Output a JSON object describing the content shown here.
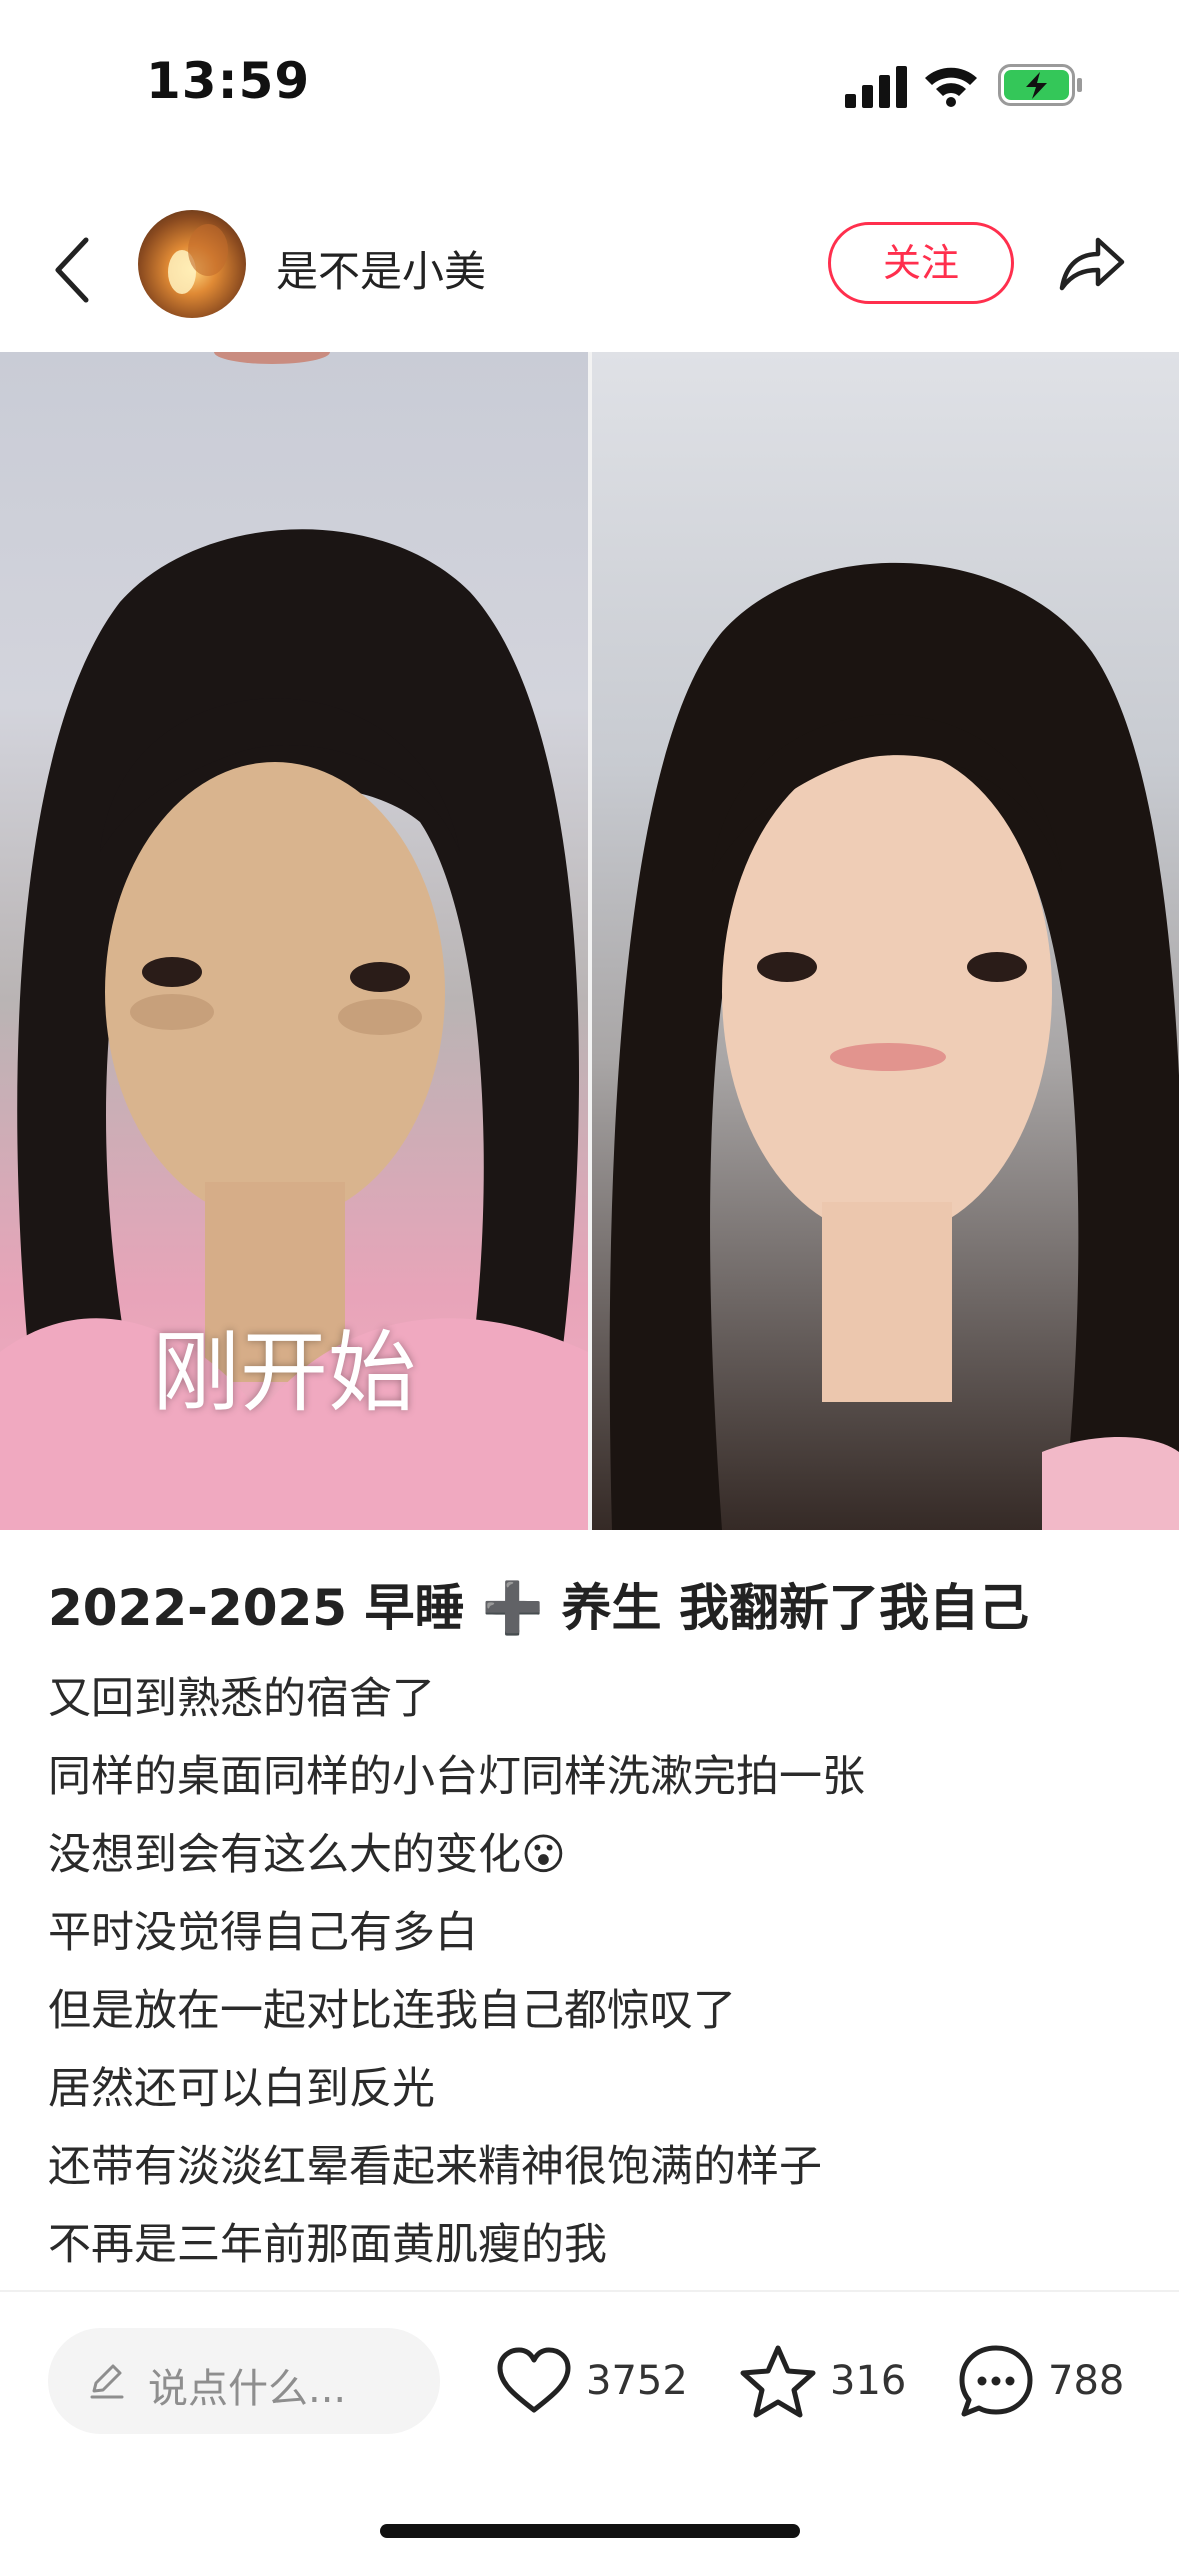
{
  "status_bar": {
    "time": "13:59"
  },
  "nav": {
    "username": "是不是小美",
    "follow_label": "关注"
  },
  "photo": {
    "caption": "刚开始"
  },
  "post": {
    "title": "2022-2025 早睡 ➕ 养生 我翻新了我自己",
    "lines": [
      "又回到熟悉的宿舍了",
      "同样的桌面同样的小台灯同样洗漱完拍一张",
      "没想到会有这么大的变化😮",
      "平时没觉得自己有多白",
      "但是放在一起对比连我自己都惊叹了",
      "居然还可以白到反光",
      "还带有淡淡红晕看起来精神很饱满的样子",
      "不再是三年前那面黄肌瘦的我"
    ]
  },
  "bottom_bar": {
    "comment_placeholder": "说点什么...",
    "likes": "3752",
    "collects": "316",
    "comments": "788"
  },
  "colors": {
    "accent": "#ff2f4d",
    "battery_green": "#34c759"
  },
  "icons": [
    "back-icon",
    "share-icon",
    "pencil-icon",
    "heart-icon",
    "star-icon",
    "comment-bubble-icon",
    "signal-icon",
    "wifi-icon",
    "battery-charging-icon"
  ]
}
